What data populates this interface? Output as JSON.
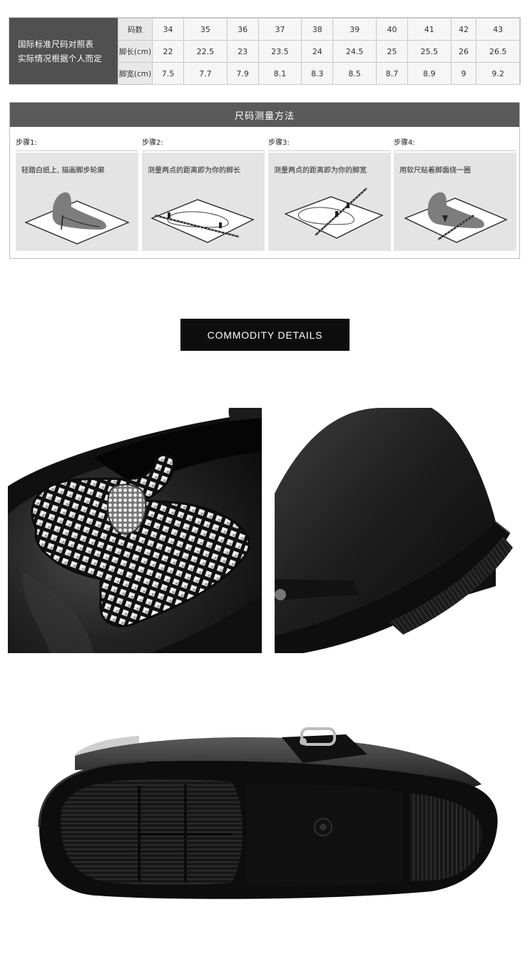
{
  "size_chart": {
    "caption_line1": "国际标准尺码对照表",
    "caption_line2": "实际情况根据个人而定",
    "row_labels": [
      "码数",
      "脚长(cm)",
      "脚宽(cm)"
    ],
    "sizes": [
      "34",
      "35",
      "36",
      "37",
      "38",
      "39",
      "40",
      "41",
      "42",
      "43"
    ],
    "foot_length": [
      "22",
      "22.5",
      "23",
      "23.5",
      "24",
      "24.5",
      "25",
      "25.5",
      "26",
      "26.5"
    ],
    "foot_width": [
      "7.5",
      "7.7",
      "7.9",
      "8.1",
      "8.3",
      "8.5",
      "8.7",
      "8.9",
      "9",
      "9.2"
    ]
  },
  "measurement": {
    "title": "尺码测量方法",
    "steps": [
      {
        "label": "步骤1:",
        "text": "轻踏白纸上, 描画脚步轮廓",
        "icon": "foot-outline-icon"
      },
      {
        "label": "步骤2:",
        "text": "测量两点的距离即为你的脚长",
        "icon": "length-ruler-icon"
      },
      {
        "label": "步骤3:",
        "text": "测量两点的距离即为你的脚宽",
        "icon": "width-ruler-icon"
      },
      {
        "label": "步骤4:",
        "text": "用软尺贴着脚面绕一圈",
        "icon": "tape-wrap-icon"
      }
    ]
  },
  "details": {
    "banner": "COMMODITY DETAILS"
  },
  "colors": {
    "caption_bg": "#505050",
    "banner_bg": "#0d0d0d",
    "shoe_black": "#141414"
  }
}
